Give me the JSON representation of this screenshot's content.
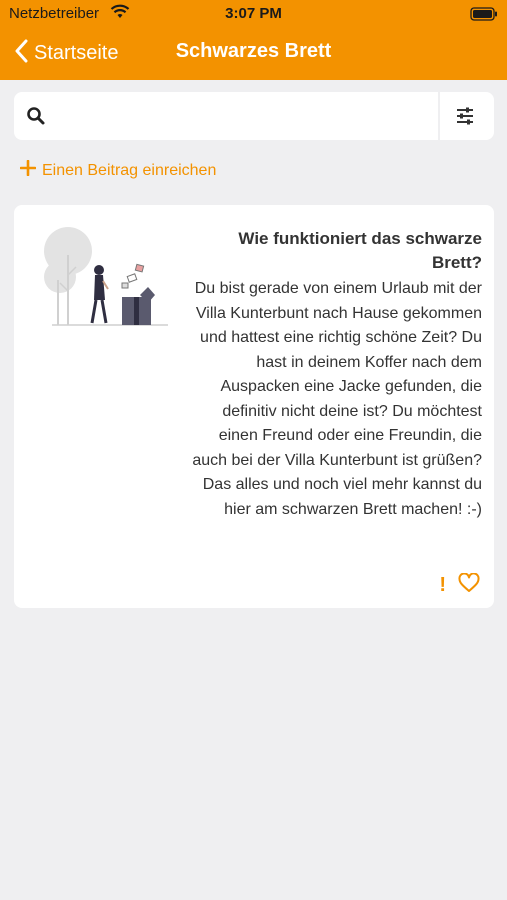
{
  "status_bar": {
    "carrier": "Netzbetreiber",
    "time": "3:07 PM"
  },
  "nav": {
    "back_label": "Startseite",
    "title": "Schwarzes Brett"
  },
  "search": {
    "placeholder": "",
    "value": ""
  },
  "actions": {
    "add_post_label": "Einen Beitrag einreichen"
  },
  "posts": [
    {
      "title": "Wie funktioniert das schwarze Brett?",
      "body": "Du bist gerade von einem Urlaub mit der Villa Kunterbunt nach Hause gekommen und hattest eine richtig schöne Zeit? Du hast in deinem Koffer nach dem Auspacken eine Jacke gefunden, die definitiv nicht deine ist? Du möchtest einen Freund oder eine Freundin, die auch bei der Villa Kunterbunt ist grüßen? Das alles und noch viel mehr kannst du hier am schwarzen Brett machen! :-)",
      "report_glyph": "!"
    }
  ],
  "colors": {
    "accent": "#f39200",
    "background": "#efeff1",
    "card": "#ffffff",
    "text": "#333333"
  },
  "icons": {
    "back": "chevron-left-icon",
    "search": "search-icon",
    "filter": "sliders-icon",
    "add": "plus-icon",
    "report": "exclamation-icon",
    "like": "heart-icon"
  }
}
